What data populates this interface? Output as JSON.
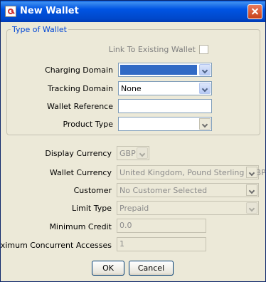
{
  "window": {
    "title": "New Wallet"
  },
  "group": {
    "title": "Type of Wallet",
    "link_existing_label": "Link To Existing Wallet",
    "charging_domain_label": "Charging Domain",
    "charging_domain_value": "",
    "tracking_domain_label": "Tracking Domain",
    "tracking_domain_value": "None",
    "wallet_reference_label": "Wallet Reference",
    "wallet_reference_value": "",
    "product_type_label": "Product Type",
    "product_type_value": ""
  },
  "form": {
    "display_currency_label": "Display Currency",
    "display_currency_value": "GBP",
    "wallet_currency_label": "Wallet Currency",
    "wallet_currency_value": "United Kingdom, Pound Sterling (GBP)",
    "customer_label": "Customer",
    "customer_value": "No Customer Selected",
    "limit_type_label": "Limit Type",
    "limit_type_value": "Prepaid",
    "minimum_credit_label": "Minimum Credit",
    "minimum_credit_value": "0.0",
    "max_concurrent_label": "Maximum Concurrent Accesses",
    "max_concurrent_value": "1"
  },
  "buttons": {
    "ok": "OK",
    "cancel": "Cancel"
  }
}
